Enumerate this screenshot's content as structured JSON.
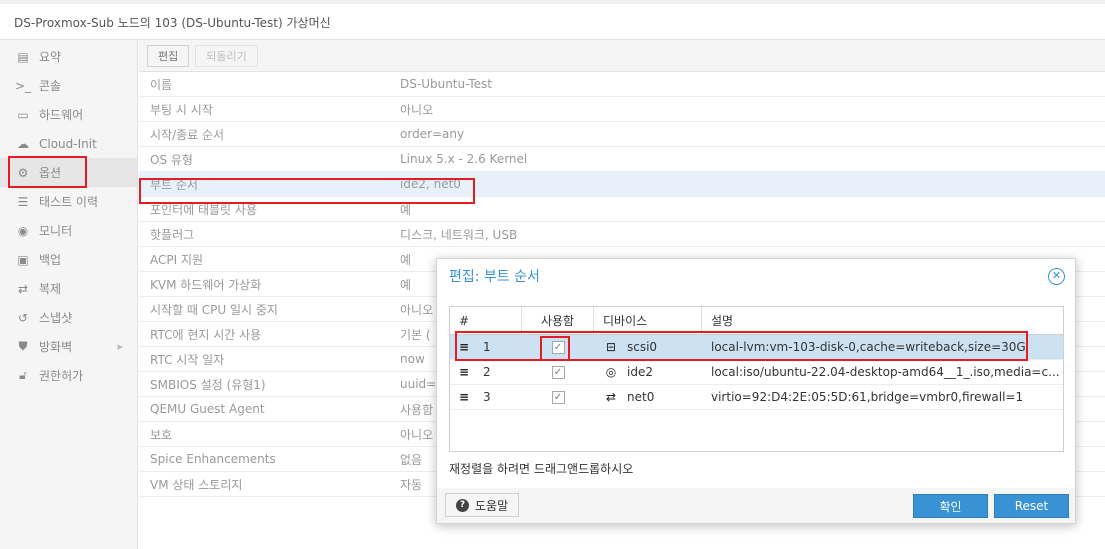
{
  "window": {
    "title": "DS-Proxmox-Sub 노드의 103 (DS-Ubuntu-Test) 가상머신"
  },
  "sidebar": {
    "items": [
      {
        "label": "요약",
        "icon": "book-icon"
      },
      {
        "label": "콘솔",
        "icon": "terminal-icon"
      },
      {
        "label": "하드웨어",
        "icon": "monitor-icon"
      },
      {
        "label": "Cloud-Init",
        "icon": "cloud-icon"
      },
      {
        "label": "옵션",
        "icon": "gear-icon"
      },
      {
        "label": "태스트 이력",
        "icon": "list-icon"
      },
      {
        "label": "모니터",
        "icon": "eye-icon"
      },
      {
        "label": "백업",
        "icon": "floppy-icon"
      },
      {
        "label": "복제",
        "icon": "retweet-icon"
      },
      {
        "label": "스냅샷",
        "icon": "history-icon"
      },
      {
        "label": "방화벽",
        "icon": "shield-icon"
      },
      {
        "label": "권한허가",
        "icon": "unlock-icon"
      }
    ]
  },
  "toolbar": {
    "edit_label": "편집",
    "revert_label": "되돌리기"
  },
  "options": [
    {
      "key": "이름",
      "value": "DS-Ubuntu-Test"
    },
    {
      "key": "부팅 시 시작",
      "value": "아니오"
    },
    {
      "key": "시작/종료 순서",
      "value": "order=any"
    },
    {
      "key": "OS 유형",
      "value": "Linux 5.x - 2.6 Kernel"
    },
    {
      "key": "부트 순서",
      "value": "ide2, net0"
    },
    {
      "key": "포인터에 태블릿 사용",
      "value": "예"
    },
    {
      "key": "핫플러그",
      "value": "디스크, 네트워크, USB"
    },
    {
      "key": "ACPI 지원",
      "value": "예"
    },
    {
      "key": "KVM 하드웨어 가상화",
      "value": "예"
    },
    {
      "key": "시작할 때 CPU 일시 중지",
      "value": "아니오"
    },
    {
      "key": "RTC에 현지 시간 사용",
      "value": "기본 ("
    },
    {
      "key": "RTC 시작 일자",
      "value": "now"
    },
    {
      "key": "SMBIOS 설정 (유형1)",
      "value": "uuid=f"
    },
    {
      "key": "QEMU Guest Agent",
      "value": "사용함"
    },
    {
      "key": "보호",
      "value": "아니오"
    },
    {
      "key": "Spice Enhancements",
      "value": "없음"
    },
    {
      "key": "VM 상태 스토리지",
      "value": "자동"
    }
  ],
  "dialog": {
    "title": "편집: 부트 순서",
    "columns": {
      "num": "#",
      "enabled": "사용함",
      "device": "디바이스",
      "desc": "설명"
    },
    "rows": [
      {
        "num": "1",
        "device": "scsi0",
        "device_icon": "hdd-icon",
        "desc": "local-lvm:vm-103-disk-0,cache=writeback,size=30G",
        "enabled": true
      },
      {
        "num": "2",
        "device": "ide2",
        "device_icon": "cdrom-icon",
        "desc": "local:iso/ubuntu-22.04-desktop-amd64__1_.iso,media=c...",
        "enabled": true
      },
      {
        "num": "3",
        "device": "net0",
        "device_icon": "exchange-icon",
        "desc": "virtio=92:D4:2E:05:5D:61,bridge=vmbr0,firewall=1",
        "enabled": true
      }
    ],
    "hint": "재정렬을 하려면 드래그앤드롭하시오",
    "help_label": "도움말",
    "ok_label": "확인",
    "reset_label": "Reset"
  }
}
